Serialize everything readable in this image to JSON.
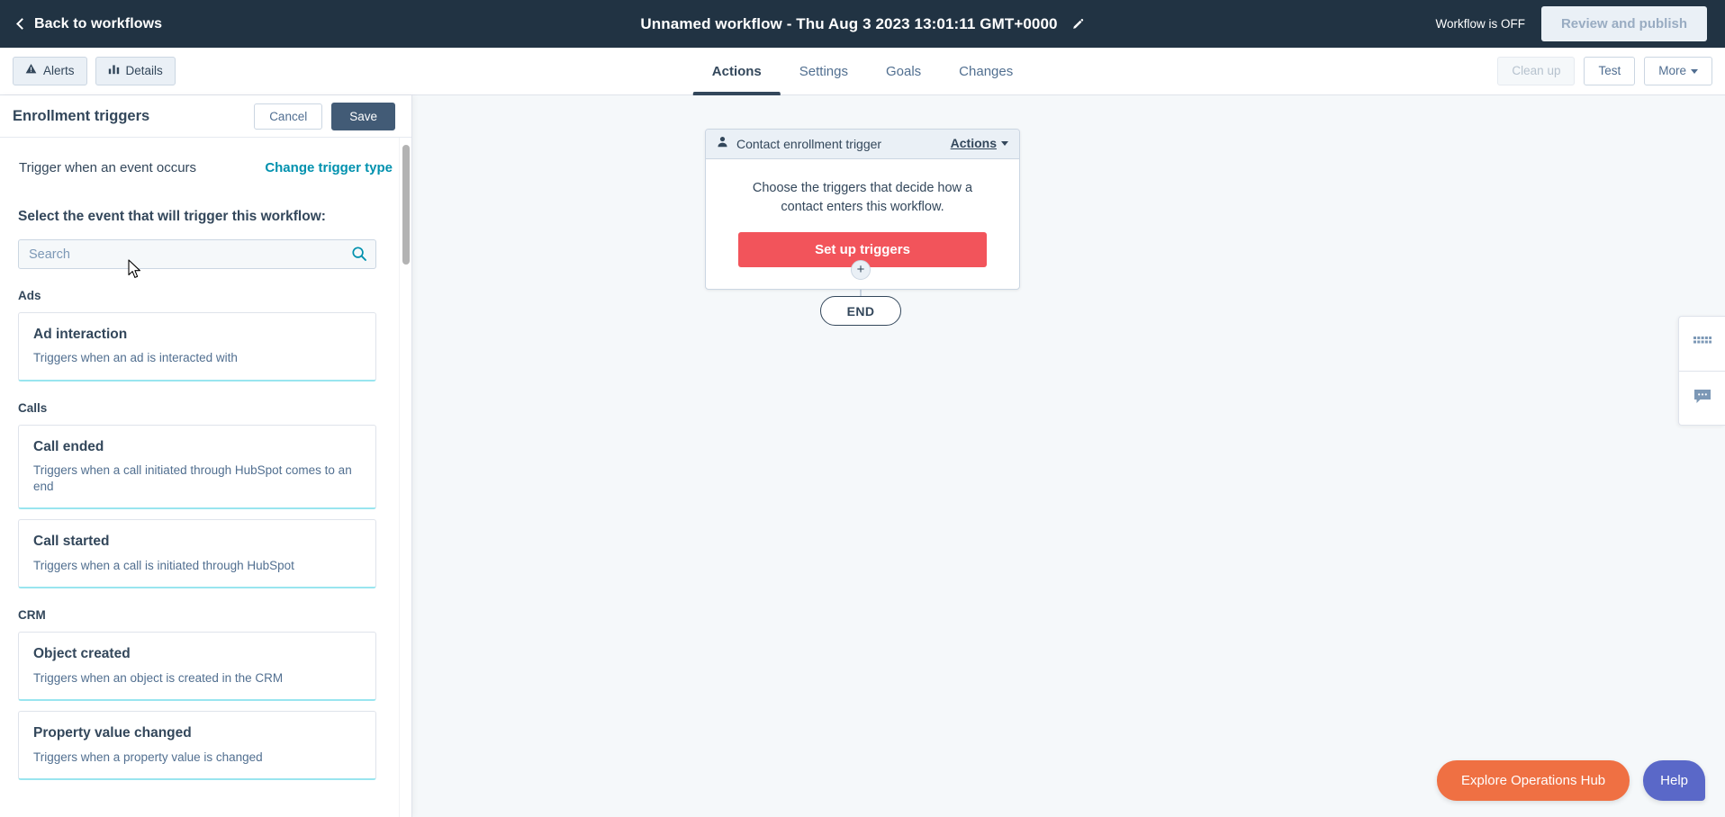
{
  "topnav": {
    "back_label": "Back to workflows",
    "back_icon": "chevron-left-icon",
    "workflow_title": "Unnamed workflow - Thu Aug 3 2023 13:01:11 GMT+0000",
    "edit_icon": "pencil-icon",
    "status_text": "Workflow is OFF",
    "review_button": "Review and publish",
    "background_color": "#213343"
  },
  "tabbar": {
    "left_buttons": [
      {
        "label": "Alerts",
        "icon": "warning-triangle-icon"
      },
      {
        "label": "Details",
        "icon": "bar-chart-icon"
      }
    ],
    "tabs": [
      {
        "label": "Actions",
        "active": true
      },
      {
        "label": "Settings",
        "active": false
      },
      {
        "label": "Goals",
        "active": false
      },
      {
        "label": "Changes",
        "active": false
      }
    ],
    "right_buttons": [
      {
        "label": "Clean up",
        "disabled": true
      },
      {
        "label": "Test",
        "disabled": false
      },
      {
        "label": "More",
        "disabled": false,
        "icon": "caret-down-icon"
      }
    ],
    "active_tab_underline_color": "#33475b"
  },
  "left_panel": {
    "title": "Enrollment triggers",
    "cancel_label": "Cancel",
    "save_label": "Save",
    "trigger_type_label": "Trigger when an event occurs",
    "change_trigger_link": "Change trigger type",
    "select_event_label": "Select the event that will trigger this workflow:",
    "search": {
      "placeholder": "Search",
      "value": "",
      "icon": "search-icon"
    },
    "groups": [
      {
        "name": "Ads",
        "events": [
          {
            "title": "Ad interaction",
            "description": "Triggers when an ad is interacted with"
          }
        ]
      },
      {
        "name": "Calls",
        "events": [
          {
            "title": "Call ended",
            "description": "Triggers when a call initiated through HubSpot comes to an end"
          },
          {
            "title": "Call started",
            "description": "Triggers when a call is initiated through HubSpot"
          }
        ]
      },
      {
        "name": "CRM",
        "events": [
          {
            "title": "Object created",
            "description": "Triggers when an object is created in the CRM"
          },
          {
            "title": "Property value changed",
            "description": "Triggers when a property value is changed"
          }
        ]
      }
    ],
    "link_color": "#0091ae",
    "card_accent_color": "#99e5ef"
  },
  "canvas": {
    "background_color": "#f5f8fa",
    "trigger_card": {
      "icon": "contact-person-icon",
      "header_title": "Contact enrollment trigger",
      "actions_label": "Actions",
      "actions_caret_icon": "caret-down-icon",
      "body_text": "Choose the triggers that decide how a contact enters this workflow.",
      "cta_label": "Set up triggers",
      "cta_color": "#f2545b"
    },
    "add_step_icon": "plus-icon",
    "end_node_label": "END"
  },
  "right_rail": {
    "items": [
      {
        "icon": "apps-grid-icon"
      },
      {
        "icon": "chat-bubble-icon"
      }
    ]
  },
  "floating": {
    "ops_hub_label": "Explore Operations Hub",
    "ops_hub_color": "#ef7043",
    "help_label": "Help",
    "help_color": "#5a68c8"
  }
}
